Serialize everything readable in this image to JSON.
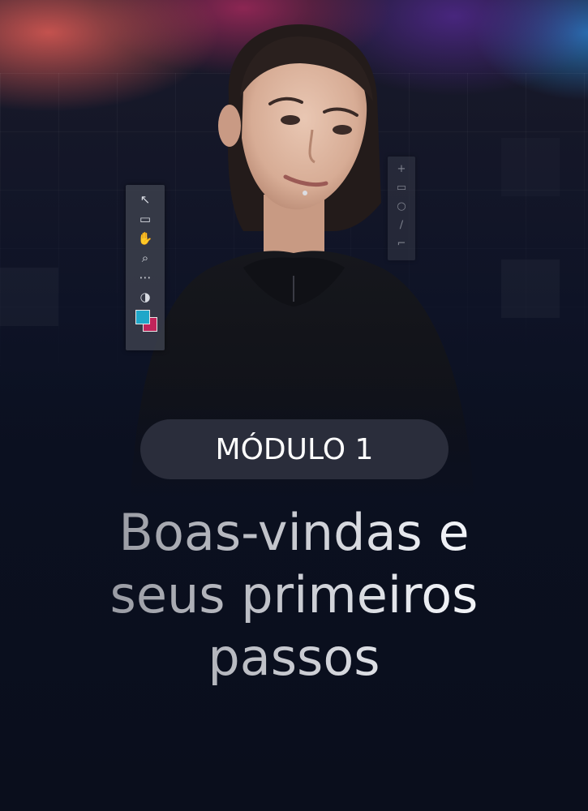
{
  "card": {
    "badge_label": "MÓDULO 1",
    "title_lines": [
      "Boas-vindas e",
      "seus primeiros",
      "passos"
    ]
  },
  "toolbar_left": {
    "tools": [
      "arrow-select-icon",
      "rectangle-icon",
      "hand-icon",
      "zoom-icon",
      "more-icon",
      "swap-colors-icon"
    ],
    "foreground_color": "#1fa7c9",
    "background_color": "#c0245a"
  },
  "toolbar_right": {
    "tools": [
      "plus-icon",
      "rectangle-icon",
      "lasso-icon",
      "brush-icon",
      "crop-icon"
    ]
  },
  "colors": {
    "background": "#0b1020",
    "badge_background": "#2a2d3b",
    "badge_text": "#ffffff"
  }
}
